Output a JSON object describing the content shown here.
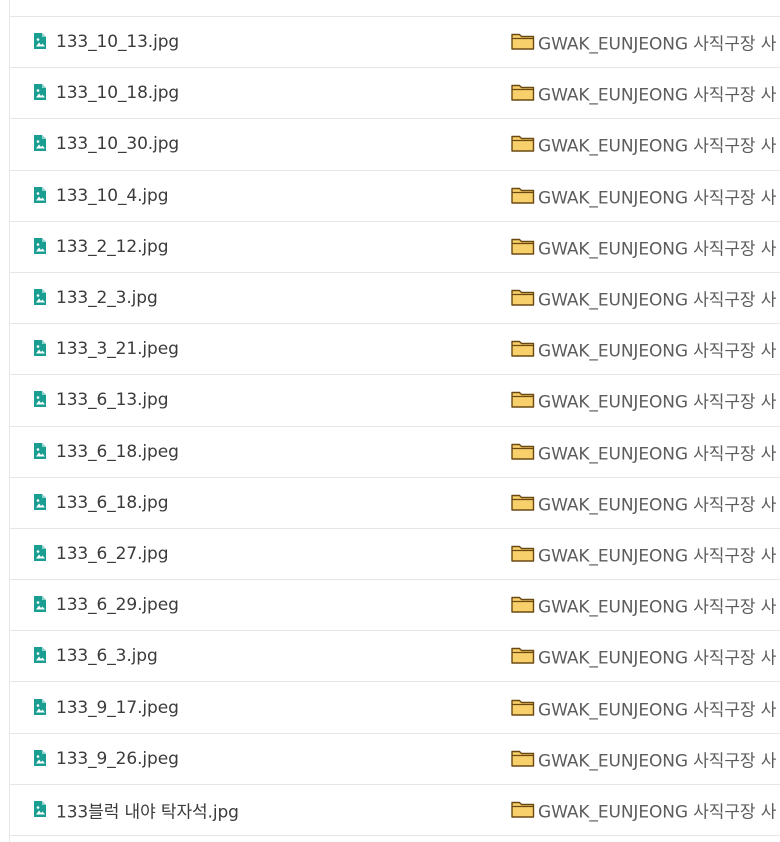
{
  "colors": {
    "file_icon": "#1a9e92",
    "folder_icon_fill": "#f7cf6b",
    "folder_icon_stroke": "#6b4a12",
    "row_divider": "#e6e6e6",
    "file_text": "#3b3b3b",
    "folder_text": "#5c5c5c"
  },
  "icons": {
    "file": "image-file-icon",
    "folder": "folder-icon"
  },
  "rows": [
    {
      "file_name": "133_10_13.jpg",
      "folder": "GWAK_EUNJEONG 사직구장 사"
    },
    {
      "file_name": "133_10_18.jpg",
      "folder": "GWAK_EUNJEONG 사직구장 사"
    },
    {
      "file_name": "133_10_30.jpg",
      "folder": "GWAK_EUNJEONG 사직구장 사"
    },
    {
      "file_name": "133_10_4.jpg",
      "folder": "GWAK_EUNJEONG 사직구장 사"
    },
    {
      "file_name": "133_2_12.jpg",
      "folder": "GWAK_EUNJEONG 사직구장 사"
    },
    {
      "file_name": "133_2_3.jpg",
      "folder": "GWAK_EUNJEONG 사직구장 사"
    },
    {
      "file_name": "133_3_21.jpeg",
      "folder": "GWAK_EUNJEONG 사직구장 사"
    },
    {
      "file_name": "133_6_13.jpg",
      "folder": "GWAK_EUNJEONG 사직구장 사"
    },
    {
      "file_name": "133_6_18.jpeg",
      "folder": "GWAK_EUNJEONG 사직구장 사"
    },
    {
      "file_name": "133_6_18.jpg",
      "folder": "GWAK_EUNJEONG 사직구장 사"
    },
    {
      "file_name": "133_6_27.jpg",
      "folder": "GWAK_EUNJEONG 사직구장 사"
    },
    {
      "file_name": "133_6_29.jpeg",
      "folder": "GWAK_EUNJEONG 사직구장 사"
    },
    {
      "file_name": "133_6_3.jpg",
      "folder": "GWAK_EUNJEONG 사직구장 사"
    },
    {
      "file_name": "133_9_17.jpeg",
      "folder": "GWAK_EUNJEONG 사직구장 사"
    },
    {
      "file_name": "133_9_26.jpeg",
      "folder": "GWAK_EUNJEONG 사직구장 사"
    },
    {
      "file_name": "133블럭 내야 탁자석.jpg",
      "folder": "GWAK_EUNJEONG 사직구장 사"
    }
  ]
}
